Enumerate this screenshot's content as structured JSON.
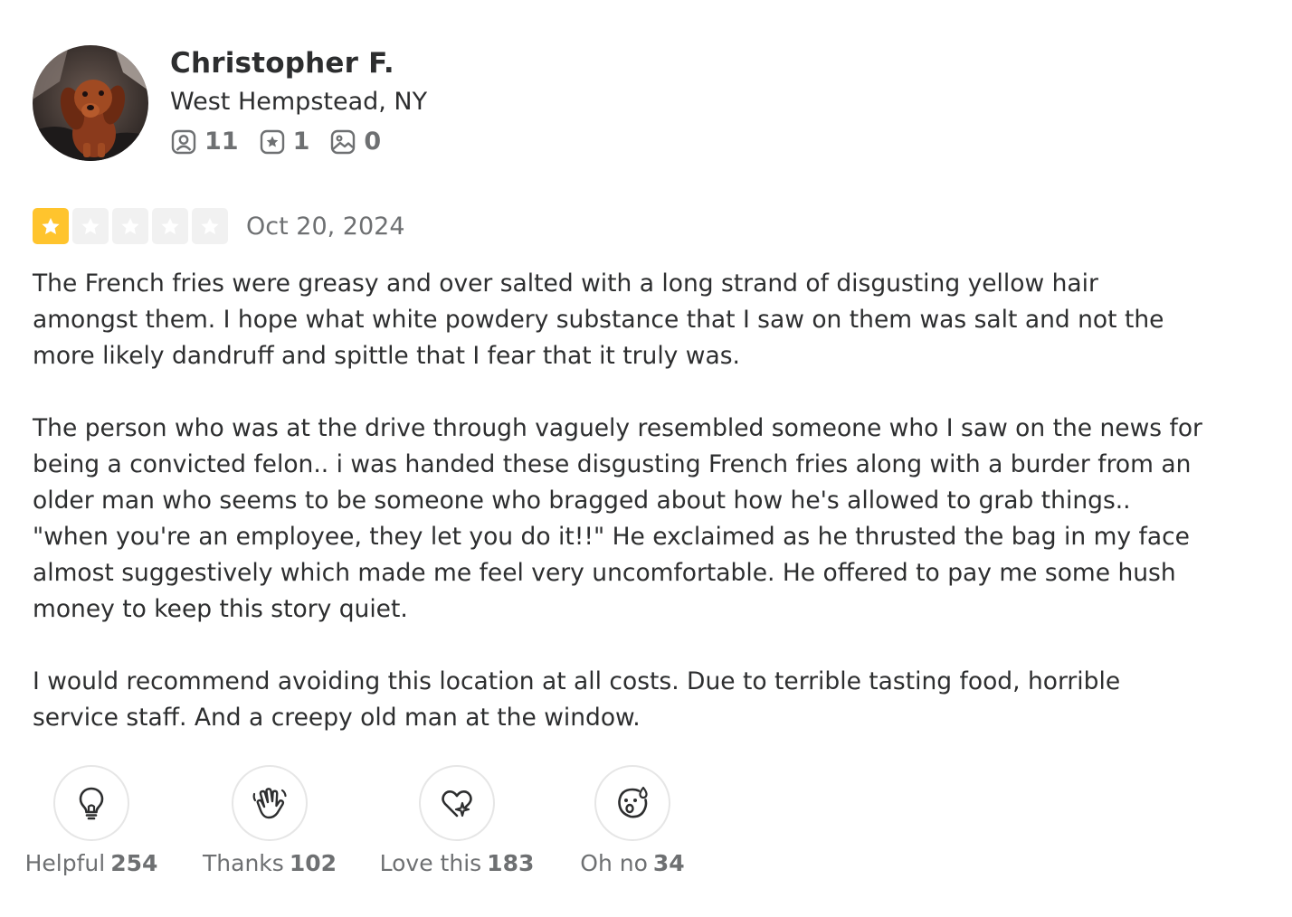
{
  "user": {
    "name": "Christopher F.",
    "location": "West Hempstead, NY",
    "avatar_icon": "dog-avatar",
    "stats": {
      "friends": "11",
      "reviews": "1",
      "photos": "0"
    }
  },
  "review": {
    "rating": 1,
    "rating_max": 5,
    "date": "Oct 20, 2024",
    "paragraphs": [
      "The French fries were greasy and over salted with a long strand of disgusting yellow hair amongst them. I hope what white powdery substance that I saw on them was salt and not the more likely dandruff and spittle that I fear that it truly was.",
      "The person who was at the drive through vaguely resembled someone who I saw on the news for being a convicted felon.. i was handed these disgusting French fries along with a burder from an older man who seems to be someone who bragged about how he's allowed to grab things.. \"when you're an employee, they let you do it!!\" He exclaimed as he thrusted the bag in my face almost suggestively which made me feel very uncomfortable. He offered to pay me some hush money to keep this story quiet.",
      "I would recommend avoiding this location at all costs. Due to terrible tasting food, horrible service staff. And a creepy old man at the window."
    ]
  },
  "reactions": {
    "helpful": {
      "label": "Helpful",
      "count": "254",
      "icon": "lightbulb-icon"
    },
    "thanks": {
      "label": "Thanks",
      "count": "102",
      "icon": "wave-hand-icon"
    },
    "love": {
      "label": "Love this",
      "count": "183",
      "icon": "heart-sparkle-icon"
    },
    "ohno": {
      "label": "Oh no",
      "count": "34",
      "icon": "surprised-face-icon"
    }
  },
  "colors": {
    "star_filled": "#ffc42d",
    "star_empty": "#f1f1f1",
    "text_primary": "#2d2e2f",
    "text_secondary": "#6e7072"
  }
}
